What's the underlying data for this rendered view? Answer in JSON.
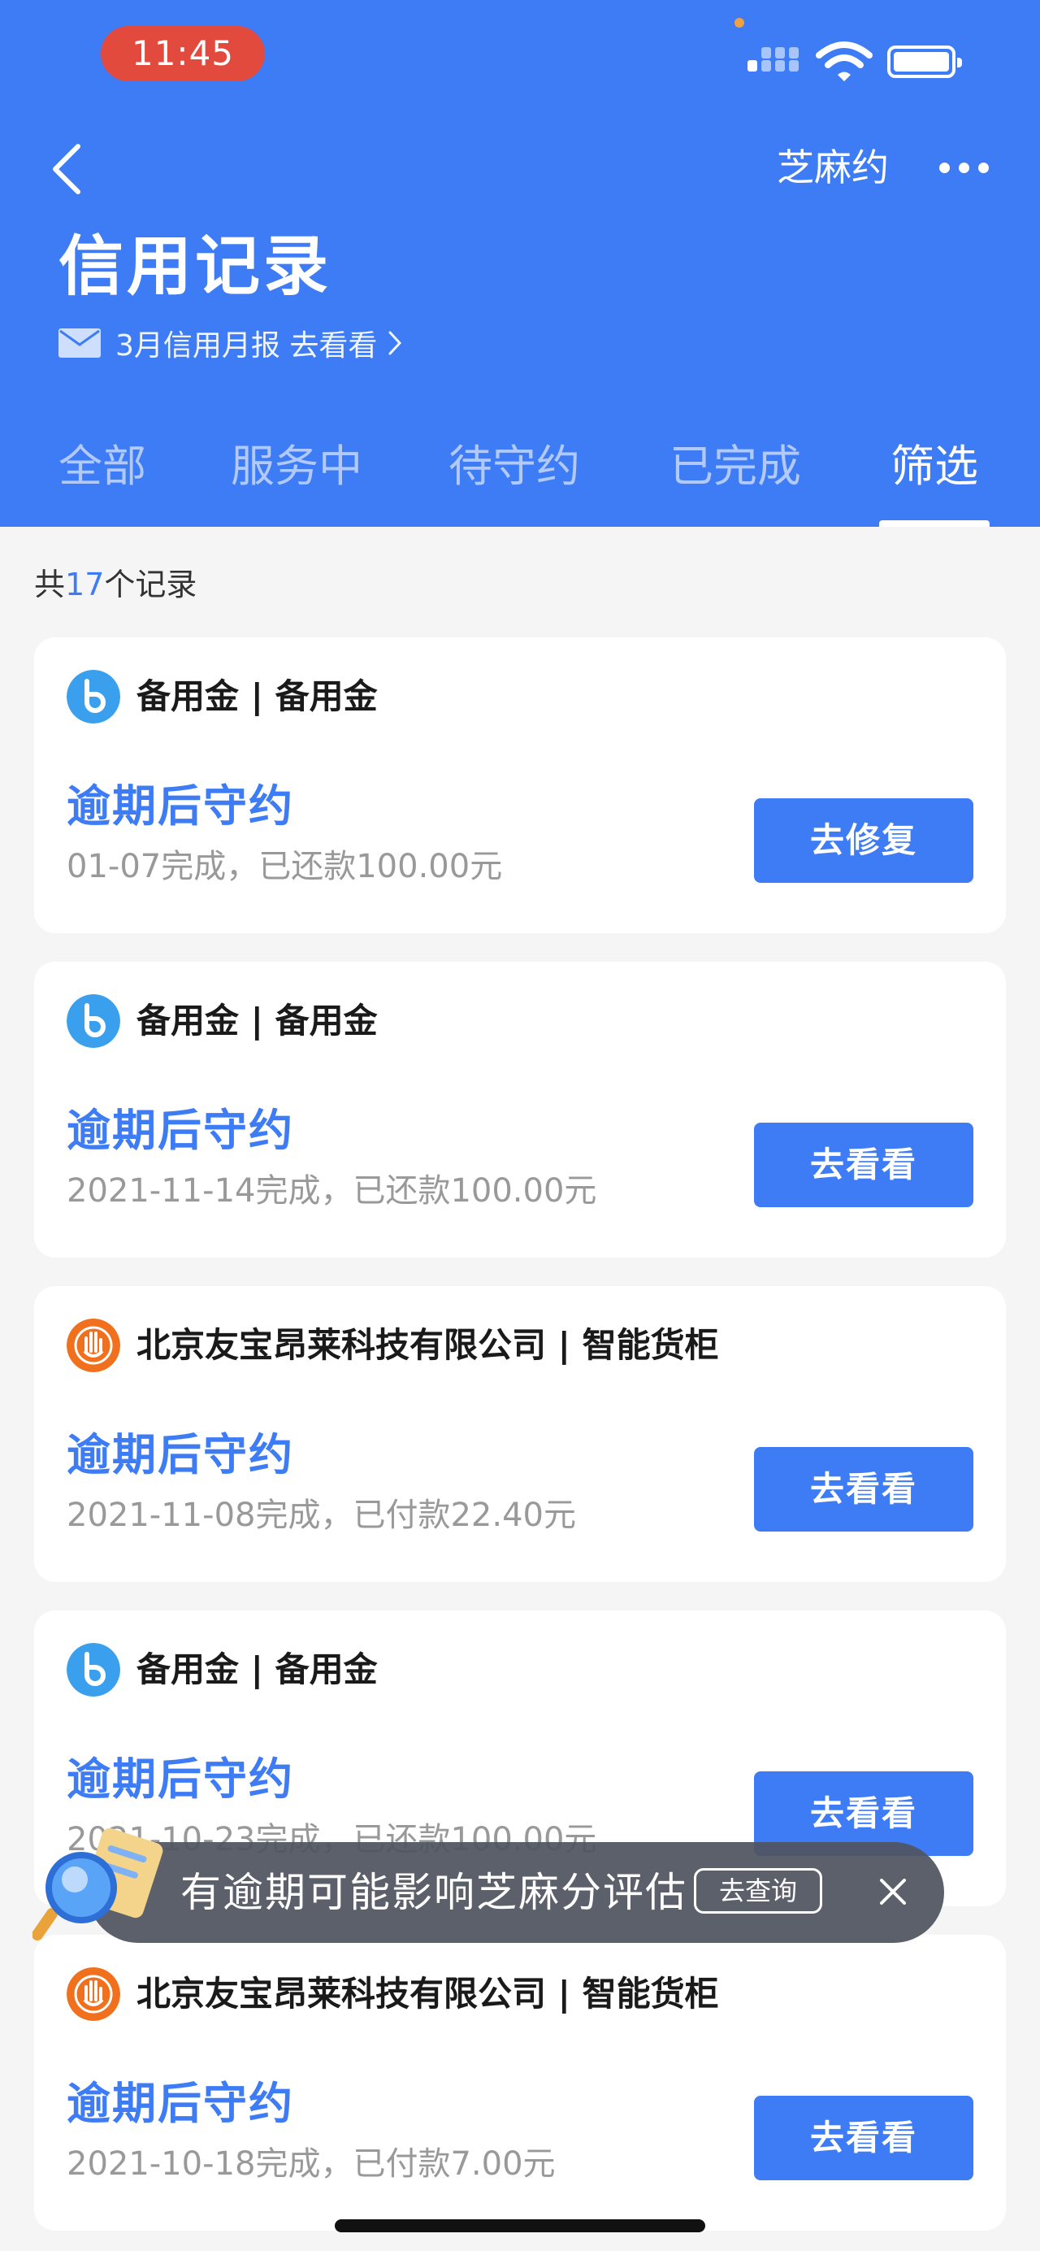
{
  "status_bar": {
    "time": "11:45"
  },
  "header": {
    "right_link": "芝麻约",
    "title": "信用记录",
    "report_text": "3月信用月报 去看看"
  },
  "tabs": [
    {
      "label": "全部",
      "active": false
    },
    {
      "label": "服务中",
      "active": false
    },
    {
      "label": "待守约",
      "active": false
    },
    {
      "label": "已完成",
      "active": false
    },
    {
      "label": "筛选",
      "active": true
    }
  ],
  "count": {
    "prefix": "共",
    "number": "17",
    "suffix": "个记录"
  },
  "cards": [
    {
      "logo": "beiyongjin-logo",
      "merchant": "备用金 | 备用金",
      "status": "逾期后守约",
      "detail": "01-07完成，已还款100.00元",
      "action": "去修复"
    },
    {
      "logo": "beiyongjin-logo",
      "merchant": "备用金 | 备用金",
      "status": "逾期后守约",
      "detail": "2021-11-14完成，已还款100.00元",
      "action": "去看看"
    },
    {
      "logo": "youbao-logo",
      "merchant": "北京友宝昂莱科技有限公司 | 智能货柜",
      "status": "逾期后守约",
      "detail": "2021-11-08完成，已付款22.40元",
      "action": "去看看"
    },
    {
      "logo": "beiyongjin-logo",
      "merchant": "备用金 | 备用金",
      "status": "逾期后守约",
      "detail": "2021-10-23完成，已还款100.00元",
      "action": "去看看"
    },
    {
      "logo": "youbao-logo",
      "merchant": "北京友宝昂莱科技有限公司 | 智能货柜",
      "status": "逾期后守约",
      "detail": "2021-10-18完成，已付款7.00元",
      "action": "去看看"
    }
  ],
  "toast": {
    "message": "有逾期可能影响芝麻分评估",
    "button": "去查询"
  },
  "colors": {
    "brand_blue": "#3d7cf5",
    "time_pill": "#e24a3d",
    "youbao_orange": "#f0701e"
  }
}
